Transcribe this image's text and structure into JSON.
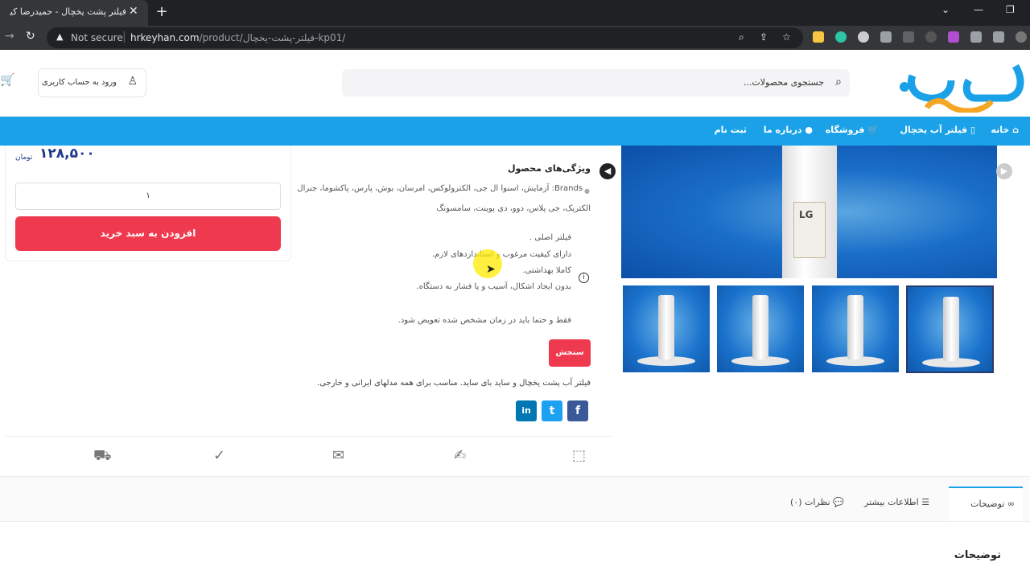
{
  "browser": {
    "tab_title": "فیلتر پشت یخچال - حمیدرضا کیهان",
    "tab_close": "✕",
    "new_tab": "+",
    "security": "Not secure",
    "url_host": "hrkeyhan.com",
    "url_path": "/product/فیلتر-پشت-یخچال-kp01/"
  },
  "header": {
    "search_placeholder": "جستجوی محصولات...",
    "login_label": "ورود به حساب کاربری"
  },
  "menu": {
    "items": [
      "خانه",
      "فیلتر آب یخچال",
      "فروشگاه",
      "درباره ما",
      "ثبت نام"
    ]
  },
  "gallery": {
    "main_label": "LG"
  },
  "product": {
    "features_title": "ویژگی‌های محصول",
    "brands_line1": "Brands: آزمایش، اسنوا ال جی، الکترولوکس، امرسان، بوش، پارس، پاکشوما، جنرال",
    "brands_line2": "الکتریک، جی پلاس، دوو، دی پوینت، سامسونگ",
    "feature_lines": [
      "فیلتر اصلی .",
      "دارای کیفیت مرغوب و استانداردهای لازم.",
      "کاملا بهداشتی.",
      "بدون ایجاد اشکال، آسیب و یا فشار به دستگاه."
    ],
    "replace_note": "فقط و حتما باید در زمان مشخص شده تعویض شود.",
    "measure_label": "سنجش",
    "short_description": "فیلتر آب پشت یخچال و ساید بای ساید. مناسب برای همه مدلهای ایرانی و خارجی.",
    "social": [
      "f",
      "t",
      "in"
    ]
  },
  "buy": {
    "price": "۱۲۸,۵۰۰",
    "currency": "تومان",
    "quantity": "۱",
    "add_to_cart": "افزودن به سبد خرید"
  },
  "tabs": {
    "items": [
      "توضیحات",
      "اطلاعات بیشتر",
      "نظرات (۰)"
    ],
    "content_heading": "توضیحات"
  },
  "colors": {
    "accent": "#1aa1e8",
    "buy_button": "#ef394e",
    "price": "#1e3a8a"
  }
}
